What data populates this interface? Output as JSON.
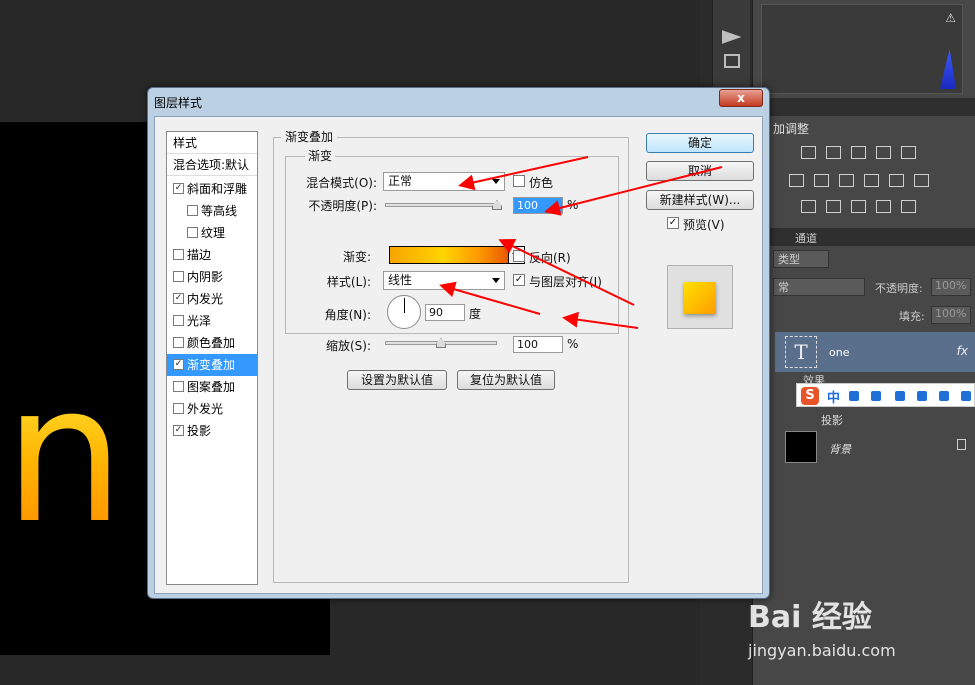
{
  "canvas": {
    "letter": "n"
  },
  "right_panel": {
    "adjust_title": "加调整",
    "channels_tab": "通道",
    "filter_type": "类型",
    "layer_mode": "常",
    "opacity_label": "不透明度:",
    "opacity_value": "100%",
    "fill_label": "填充:",
    "fill_value": "100%",
    "layers": [
      {
        "name": "one",
        "thumb": "T",
        "fx": "fx"
      },
      {
        "name": "背景"
      }
    ],
    "effects_label": "效果",
    "shadow_label": "投影"
  },
  "ime": {
    "logo": "S",
    "mode": "中"
  },
  "watermark": {
    "brand": "Bai 经验",
    "url": "jingyan.baidu.com"
  },
  "dialog": {
    "title": "图层样式",
    "close_label": "x",
    "styles_list": {
      "header": "样式",
      "blend_defaults": "混合选项:默认",
      "items": [
        {
          "label": "斜面和浮雕",
          "checked": "✓",
          "sub": false,
          "selected": false
        },
        {
          "label": "等高线",
          "checked": "",
          "sub": true,
          "selected": false
        },
        {
          "label": "纹理",
          "checked": "",
          "sub": true,
          "selected": false
        },
        {
          "label": "描边",
          "checked": "",
          "sub": false,
          "selected": false
        },
        {
          "label": "内阴影",
          "checked": "",
          "sub": false,
          "selected": false
        },
        {
          "label": "内发光",
          "checked": "✓",
          "sub": false,
          "selected": false
        },
        {
          "label": "光泽",
          "checked": "",
          "sub": false,
          "selected": false
        },
        {
          "label": "颜色叠加",
          "checked": "",
          "sub": false,
          "selected": false
        },
        {
          "label": "渐变叠加",
          "checked": "✓",
          "sub": false,
          "selected": true
        },
        {
          "label": "图案叠加",
          "checked": "",
          "sub": false,
          "selected": false
        },
        {
          "label": "外发光",
          "checked": "",
          "sub": false,
          "selected": false
        },
        {
          "label": "投影",
          "checked": "✓",
          "sub": false,
          "selected": false
        }
      ]
    },
    "gradient_overlay": {
      "group_title": "渐变叠加",
      "subgroup_title": "渐变",
      "blend_mode_label": "混合模式(O):",
      "blend_mode_value": "正常",
      "dither_label": "仿色",
      "dither_checked": "",
      "opacity_label": "不透明度(P):",
      "opacity_value": "100",
      "opacity_unit": "%",
      "gradient_label": "渐变:",
      "reverse_label": "反向(R)",
      "reverse_checked": "",
      "style_label": "样式(L):",
      "style_value": "线性",
      "align_label": "与图层对齐(I)",
      "align_checked": "✓",
      "angle_label": "角度(N):",
      "angle_value": "90",
      "angle_unit": "度",
      "scale_label": "缩放(S):",
      "scale_value": "100",
      "scale_unit": "%",
      "make_default_label": "设置为默认值",
      "reset_default_label": "复位为默认值",
      "opacity_fraction": 1.0,
      "scale_fraction": 0.5
    },
    "buttons": {
      "ok": "确定",
      "cancel": "取消",
      "new_style": "新建样式(W)...",
      "preview_label": "预览(V)",
      "preview_checked": "✓"
    },
    "colors": {
      "accent_selection": "#3399ff",
      "annotation_red": "#ff0000"
    }
  }
}
